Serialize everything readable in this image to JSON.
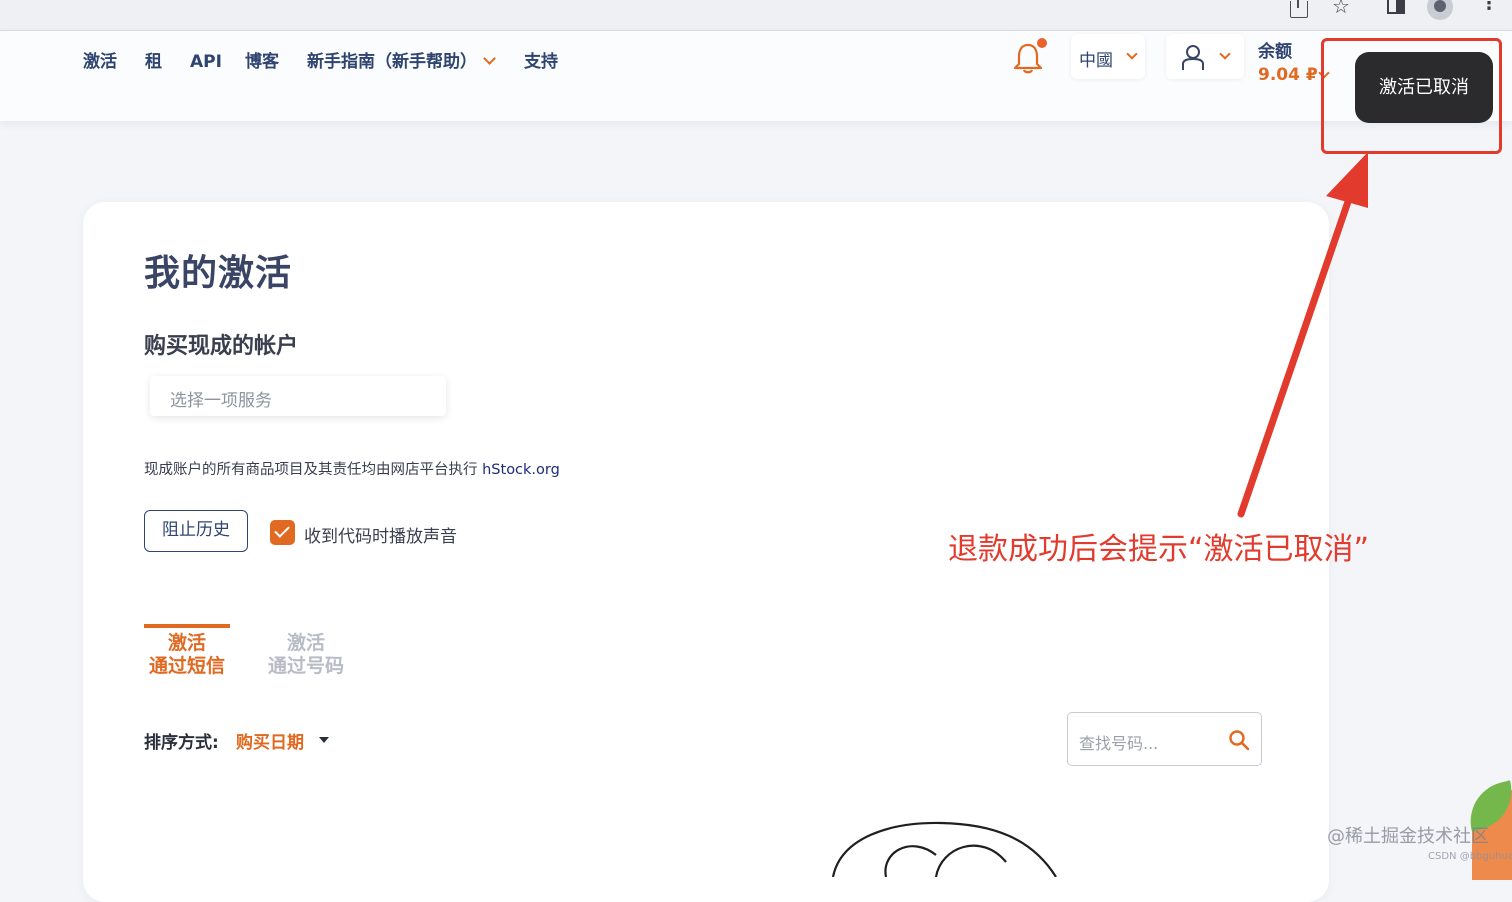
{
  "header": {
    "nav": [
      {
        "label": "激活"
      },
      {
        "label": "租"
      },
      {
        "label": "API"
      },
      {
        "label": "博客"
      },
      {
        "label": "新手指南（新手帮助）"
      },
      {
        "label": "支持"
      }
    ],
    "language": "中國",
    "balance_label": "余额",
    "balance_value": "9.04 ₽"
  },
  "toast": {
    "message": "激活已取消"
  },
  "main": {
    "title": "我的激活",
    "section_title": "购买现成的帐户",
    "service_placeholder": "选择一项服务",
    "disclaimer_text": "现成账户的所有商品项目及其责任均由网店平台执行 ",
    "disclaimer_link": "hStock.org",
    "history_button": "阻止历史",
    "sound_checkbox": {
      "label": "收到代码时播放声音",
      "checked": true
    },
    "tabs": [
      {
        "line1": "激活",
        "line2": "通过短信",
        "active": true
      },
      {
        "line1": "激活",
        "line2": "通过号码",
        "active": false
      }
    ],
    "sort_label": "排序方式:",
    "sort_value": "购买日期",
    "search_placeholder": "查找号码..."
  },
  "annotation": {
    "text": "退款成功后会提示“激活已取消”"
  },
  "watermark": {
    "main": "@稀土掘金技术社区",
    "small": "CSDN @bbguhuang"
  },
  "colors": {
    "accent": "#e06a22",
    "nav": "#2f4470",
    "annotation": "#e23b2e",
    "toast_bg": "#2b2b2e"
  }
}
